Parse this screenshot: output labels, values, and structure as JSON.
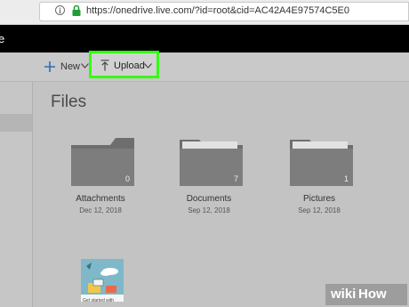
{
  "browser": {
    "url": "https://onedrive.live.com/?id=root&cid=AC42A4E97574C5E0",
    "info_icon": "i"
  },
  "topbar": {
    "fragment": "e"
  },
  "toolbar": {
    "new_label": "New",
    "upload_label": "Upload",
    "highlight_color": "#33ff11"
  },
  "main": {
    "title": "Files",
    "folders": [
      {
        "name": "Attachments",
        "date": "Dec 12, 2018",
        "count": "0"
      },
      {
        "name": "Documents",
        "date": "Sep 12, 2018",
        "count": "7"
      },
      {
        "name": "Pictures",
        "date": "Sep 12, 2018",
        "count": "1"
      }
    ],
    "file_caption": "Get started with"
  },
  "watermark": {
    "wiki": "wiki",
    "how": "How"
  }
}
